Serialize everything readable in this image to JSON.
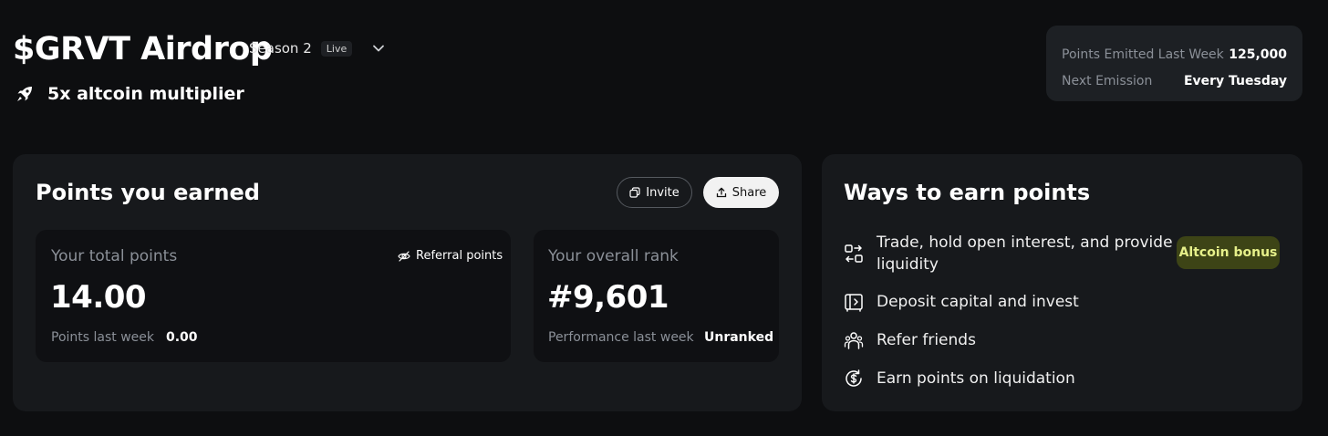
{
  "header": {
    "title": "$GRVT Airdrop",
    "season_label": "Season 2",
    "live_badge": "Live",
    "multiplier_label": "5x altcoin multiplier"
  },
  "emission": {
    "points_emitted_label": "Points Emitted Last Week",
    "points_emitted_value": "125,000",
    "next_emission_label": "Next Emission",
    "next_emission_value": "Every Tuesday"
  },
  "points_card": {
    "title": "Points you earned",
    "invite_label": "Invite",
    "share_label": "Share",
    "total": {
      "label": "Your total points",
      "referral_label": "Referral points",
      "value": "14.00",
      "last_week_label": "Points last week",
      "last_week_value": "0.00"
    },
    "rank": {
      "label": "Your overall rank",
      "value": "#9,601",
      "performance_label": "Performance last week",
      "performance_value": "Unranked"
    }
  },
  "ways_card": {
    "title": "Ways to earn points",
    "items": [
      {
        "label": "Trade, hold open interest, and provide",
        "label_line2": "liquidity",
        "icon": "swap-icon"
      },
      {
        "label": "Deposit capital and invest",
        "icon": "vault-icon"
      },
      {
        "label": "Refer friends",
        "icon": "users-icon"
      },
      {
        "label": "Earn points on liquidation",
        "icon": "liquidation-icon"
      }
    ],
    "altcoin_badge": "Altcoin bonus"
  },
  "colors": {
    "background": "#0d0e10",
    "card": "#17191c",
    "inner_card": "#0f1013",
    "muted_text": "#8b9098",
    "badge_bg": "#3d4416",
    "badge_text": "#e6f08a"
  }
}
